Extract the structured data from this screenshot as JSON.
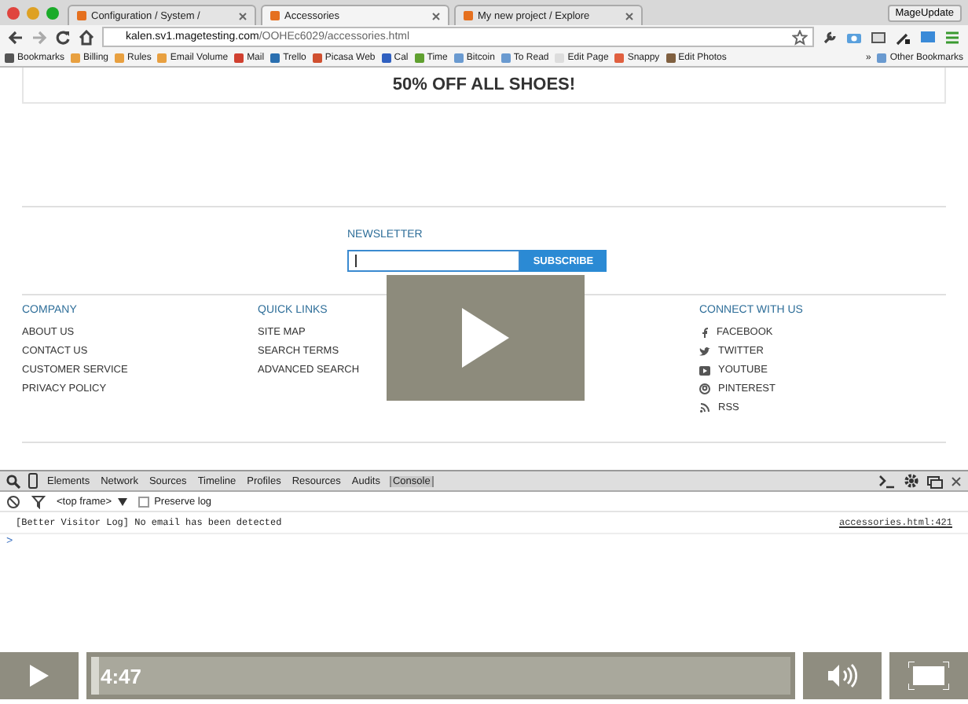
{
  "browser": {
    "tabs": [
      {
        "title": "Configuration / System /",
        "selected": false
      },
      {
        "title": "Accessories",
        "selected": true
      },
      {
        "title": "My new project / Explore",
        "selected": false
      }
    ],
    "profile_button": "MageUpdate",
    "address": {
      "host": "kalen.sv1.magetesting.com",
      "path": "/OOHEc6029/accessories.html"
    },
    "bookmarks": [
      {
        "label": "Bookmarks",
        "color": "#555555"
      },
      {
        "label": "Billing",
        "color": "#e8a040"
      },
      {
        "label": "Rules",
        "color": "#e8a040"
      },
      {
        "label": "Email Volume",
        "color": "#e8a040"
      },
      {
        "label": "Mail",
        "color": "#d04030"
      },
      {
        "label": "Trello",
        "color": "#2a6fb0"
      },
      {
        "label": "Picasa Web",
        "color": "#d05030"
      },
      {
        "label": "Cal",
        "color": "#3060c0"
      },
      {
        "label": "Time",
        "color": "#60a030"
      },
      {
        "label": "Bitcoin",
        "color": "#6a9ad0"
      },
      {
        "label": "To Read",
        "color": "#6a9ad0"
      },
      {
        "label": "Edit Page",
        "color": "#dddddd"
      },
      {
        "label": "Snappy",
        "color": "#e06040"
      },
      {
        "label": "Edit Photos",
        "color": "#806040"
      }
    ],
    "more": "»",
    "other_bookmarks": "Other Bookmarks"
  },
  "page": {
    "banner": "50% OFF ALL SHOES!",
    "newsletter": {
      "heading": "NEWSLETTER",
      "button": "SUBSCRIBE"
    },
    "columns": [
      {
        "heading": "COMPANY",
        "links": [
          "ABOUT US",
          "CONTACT US",
          "CUSTOMER SERVICE",
          "PRIVACY POLICY"
        ]
      },
      {
        "heading": "QUICK LINKS",
        "links": [
          "SITE MAP",
          "SEARCH TERMS",
          "ADVANCED SEARCH"
        ]
      }
    ],
    "social": {
      "heading": "CONNECT WITH US",
      "links": [
        {
          "label": "FACEBOOK",
          "kind": "facebook"
        },
        {
          "label": "TWITTER",
          "kind": "twitter"
        },
        {
          "label": "YOUTUBE",
          "kind": "youtube"
        },
        {
          "label": "PINTEREST",
          "kind": "pinterest"
        },
        {
          "label": "RSS",
          "kind": "rss"
        }
      ]
    }
  },
  "devtools": {
    "tabs": [
      {
        "label": "Elements",
        "selected": false
      },
      {
        "label": "Network",
        "selected": false
      },
      {
        "label": "Sources",
        "selected": false
      },
      {
        "label": "Timeline",
        "selected": false
      },
      {
        "label": "Profiles",
        "selected": false
      },
      {
        "label": "Resources",
        "selected": false
      },
      {
        "label": "Audits",
        "selected": false
      },
      {
        "label": "Console",
        "selected": true
      }
    ],
    "frame": "<top frame>",
    "preserve_log": {
      "label": "Preserve log",
      "checked": false
    },
    "log": {
      "message": "[Better Visitor Log] No email has been detected",
      "source": "accessories.html:421"
    },
    "prompt": ">"
  },
  "player": {
    "time": "4:47",
    "level": 0.01
  }
}
